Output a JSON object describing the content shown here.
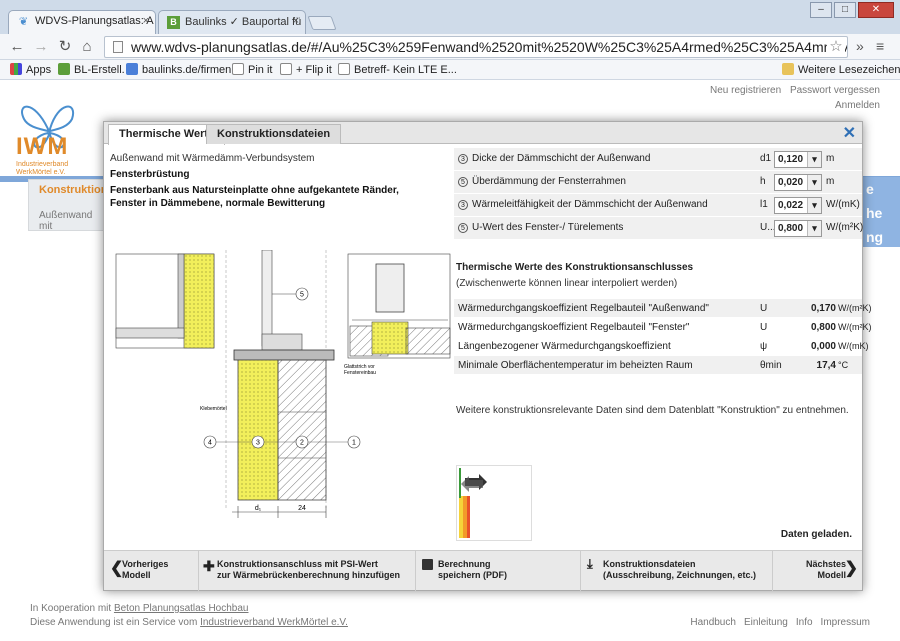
{
  "browser": {
    "tabs": [
      {
        "title": "WDVS-Planungsatlas: A",
        "active": true
      },
      {
        "title": "Baulinks ✓ Bauportal fü",
        "active": false
      }
    ],
    "url": "www.wdvs-planungsatlas.de/#/Au%25C3%259Fenwand%2520mit%2520W%25C3%25A4rmed%25C3%25A4mm-Verbundsystem/Fen",
    "bookmarks": [
      "Apps",
      "BL-Erstell.",
      "baulinks.de/firmen",
      "Pin it",
      "+ Flip it",
      "Betreff- Kein LTE E..."
    ],
    "other_bookmarks": "Weitere Lesezeichen"
  },
  "site": {
    "logo_text": "IWM",
    "logo_sub1": "Industrieverband",
    "logo_sub2": "WerkMörtel e.V.",
    "links": [
      "Neu registrieren",
      "Passwort vergessen",
      "Anmelden"
    ],
    "left_panel_title": "Konstruktioner",
    "left_panel_sub": "Außenwand mit",
    "right_blue_1": "e",
    "right_blue_2": "he",
    "right_blue_3": "ng",
    "footer_line1_prefix": "In Kooperation mit",
    "footer_line1_link": "Beton Planungsatlas Hochbau",
    "footer_line2_prefix": "Diese Anwendung ist ein Service vom",
    "footer_line2_link": "Industrieverband WerkMörtel e.V.",
    "footer_links": [
      "Handbuch",
      "Einleitung",
      "Info",
      "Impressum"
    ]
  },
  "modal": {
    "tabs": [
      "Thermische Werte",
      "Konstruktionsdateien"
    ],
    "subtitle": "Außenwand mit Wärmedämm-Verbundsystem",
    "detail_title": "Fensterbrüstung",
    "detail_desc": "Fensterbank aus  Natursteinplatte ohne aufgekantete Ränder, Fenster in Dämmebene, normale Bewitterung",
    "drawing": {
      "label_kleber": "Klebemörtel",
      "label_estrich": "Glattstrich vor Fenstereinbau",
      "dim_d": "d₁",
      "dim_24": "24",
      "circ": [
        "1",
        "2",
        "3",
        "4",
        "5"
      ]
    },
    "params": [
      {
        "num": "3",
        "label": "Dicke der Dämmschicht der Außenwand",
        "sym": "d1",
        "value": "0,120",
        "unit": "m"
      },
      {
        "num": "5",
        "label": "Überdämmung der Fensterrahmen",
        "sym": "h",
        "value": "0,020",
        "unit": "m"
      },
      {
        "num": "3",
        "label": "Wärmeleitfähigkeit der Dämmschicht der Außenwand",
        "sym": "l1",
        "value": "0,022",
        "unit": "W/(mK)"
      },
      {
        "num": "5",
        "label": "U-Wert des Fenster-/ Türelements",
        "sym": "U...",
        "value": "0,800",
        "unit": "W/(m²K)"
      }
    ],
    "thermal_title": "Thermische Werte des Konstruktionsanschlusses",
    "thermal_sub": "(Zwischenwerte können linear interpoliert werden)",
    "results": [
      {
        "label": "Wärmedurchgangskoeffizient Regelbauteil \"Außenwand\"",
        "sym": "U",
        "value": "0,170",
        "unit": "W/(m²K)"
      },
      {
        "label": "Wärmedurchgangskoeffizient Regelbauteil \"Fenster\"",
        "sym": "U",
        "value": "0,800",
        "unit": "W/(m²K)"
      },
      {
        "label": "Längenbezogener Wärmedurchgangskoeffizient",
        "sym": "ψ",
        "value": "0,000",
        "unit": "W/(mK)"
      },
      {
        "label": "Minimale Oberflächentemperatur im beheizten Raum",
        "sym": "θmin",
        "value": "17,4",
        "unit": "°C"
      }
    ],
    "note": "Weitere konstruktionsrelevante Daten sind dem Datenblatt \"Konstruktion\" zu entnehmen.",
    "loaded": "Daten geladen.",
    "buttons": {
      "prev": [
        "Vorheriges",
        "Modell"
      ],
      "psi": [
        "Konstruktionsanschluss mit PSI-Wert",
        "zur Wärmebrückenberechnung hinzufügen"
      ],
      "calc": [
        "Berechnung",
        "speichern (PDF)"
      ],
      "files": [
        "Konstruktionsdateien",
        "(Ausschreibung, Zeichnungen, etc.)"
      ],
      "next": [
        "Nächstes",
        "Modell"
      ]
    }
  }
}
